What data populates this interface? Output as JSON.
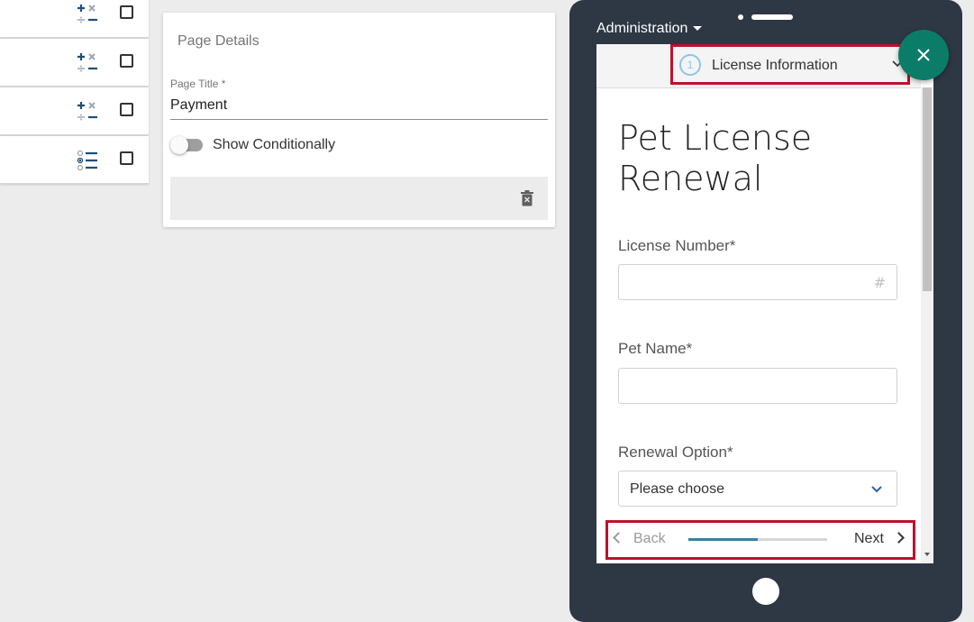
{
  "left_list": {
    "rows": [
      {
        "icon": "plus-minus-calculation-icon",
        "checked": false
      },
      {
        "icon": "plus-minus-calculation-icon",
        "checked": false
      },
      {
        "icon": "plus-minus-calculation-icon",
        "checked": false
      },
      {
        "icon": "radio-list-icon",
        "checked": false
      }
    ]
  },
  "page_details": {
    "title": "Page Details",
    "page_title_label": "Page Title *",
    "page_title_value": "Payment",
    "show_conditionally_label": "Show Conditionally",
    "show_conditionally_on": false,
    "delete_icon": "trash-icon"
  },
  "device": {
    "menu_label": "Administration",
    "step": {
      "number": "1",
      "label": "License Information"
    },
    "form_title": "Pet License Renewal",
    "fields": {
      "license_number_label": "License Number*",
      "license_number_value": "",
      "pet_name_label": "Pet Name*",
      "pet_name_value": "",
      "renewal_option_label": "Renewal Option*",
      "renewal_option_value": "Please choose"
    },
    "nav": {
      "back_label": "Back",
      "next_label": "Next",
      "progress_fraction": 0.5
    },
    "fab_icon": "close-icon"
  },
  "colors": {
    "device_frame": "#2e3744",
    "fab": "#0b7c68",
    "highlight": "#c0102c",
    "progress": "#3d7ea0",
    "step_circle": "#8fc4e8"
  }
}
